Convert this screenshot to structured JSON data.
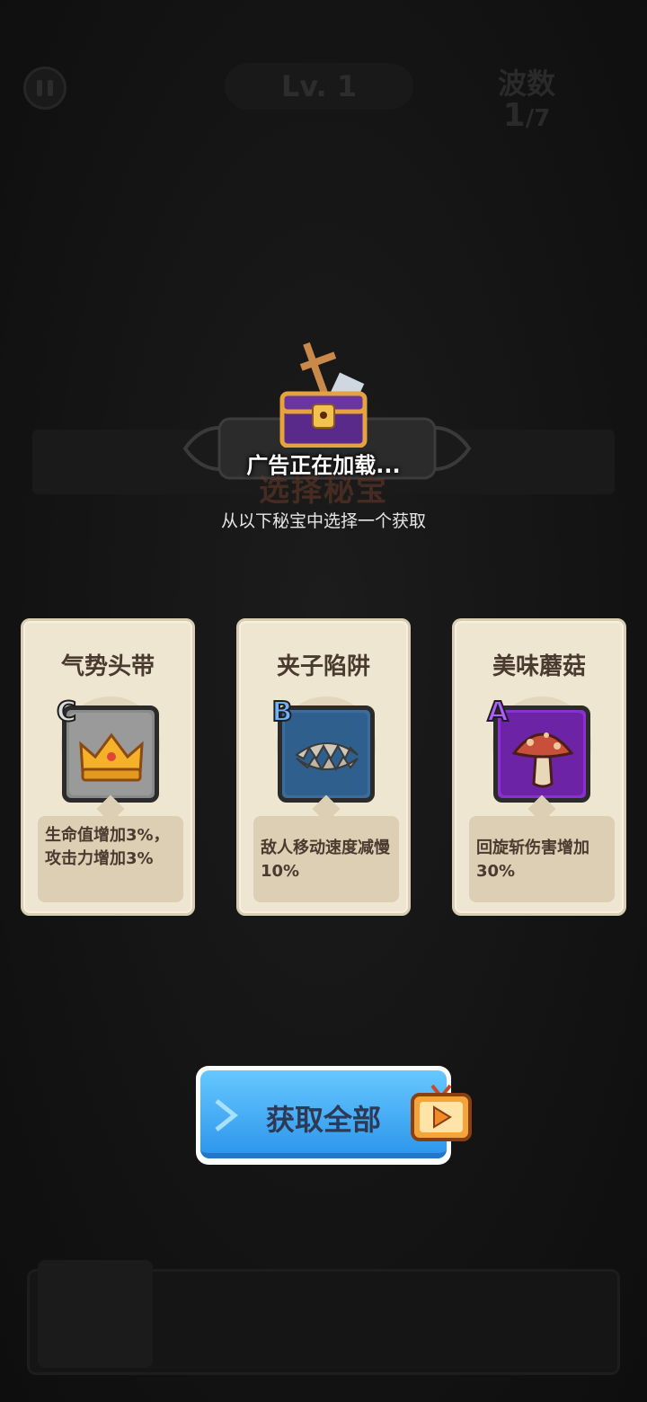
{
  "hud": {
    "level": "Lv. 1",
    "wave_label": "波数",
    "wave_current": "1",
    "wave_total": "/7"
  },
  "header": {
    "title_obscured": "选择秘宝",
    "loading": "广告正在加载...",
    "subtitle": "从以下秘宝中选择一个获取"
  },
  "cards": [
    {
      "name": "气势头带",
      "rarity": "C",
      "description": "生命值增加3%，攻击力增加3%",
      "icon": "crown-icon",
      "rarity_color": "#dcdcdc",
      "frame_color": "#7a7a7a"
    },
    {
      "name": "夹子陷阱",
      "rarity": "B",
      "description": "敌人移动速度减慢10%",
      "icon": "bear-trap-icon",
      "rarity_color": "#6fb3ff",
      "frame_color": "#3a6d9c"
    },
    {
      "name": "美味蘑菇",
      "rarity": "A",
      "description": "回旋斩伤害增加30%",
      "icon": "mushroom-icon",
      "rarity_color": "#b05cff",
      "frame_color": "#8a2fd0"
    }
  ],
  "actions": {
    "get_all_label": "获取全部",
    "ad_icon": "tv-play-icon"
  }
}
